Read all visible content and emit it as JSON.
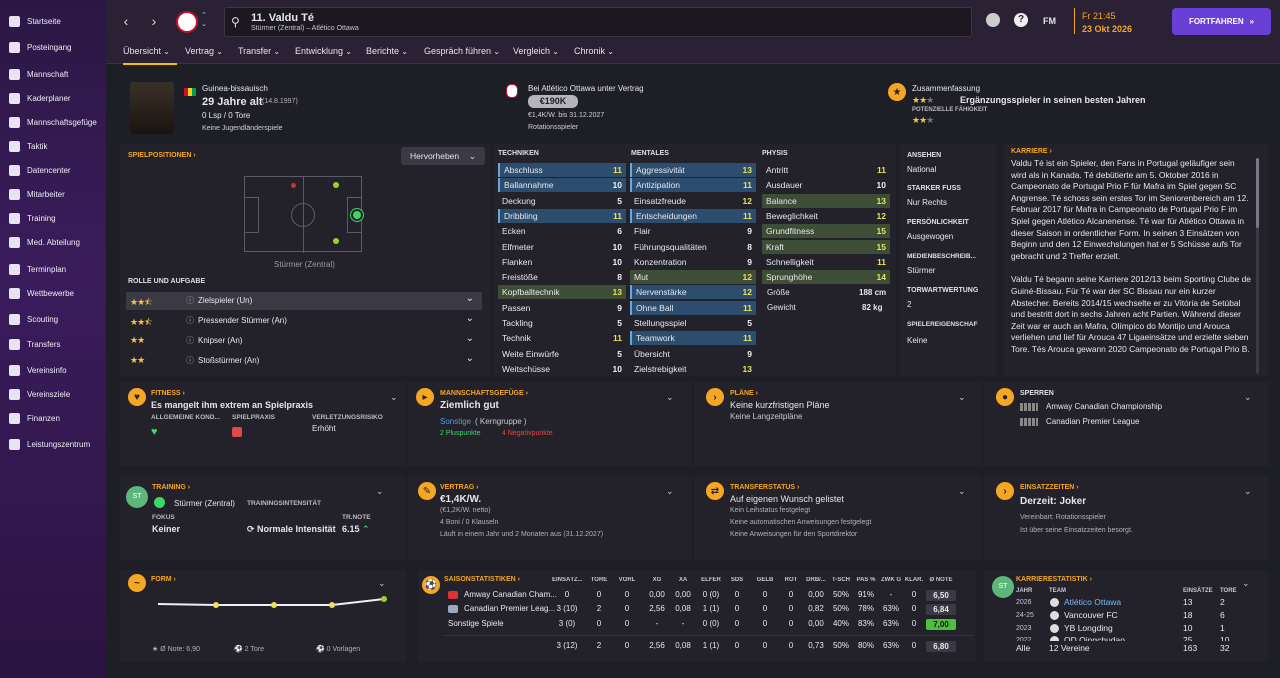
{
  "sidebar": {
    "items": [
      "Startseite",
      "Posteingang",
      "Mannschaft",
      "Kaderplaner",
      "Mannschaftsgefüge",
      "Taktik",
      "Datencenter",
      "Mitarbeiter",
      "Training",
      "Med. Abteilung",
      "Terminplan",
      "Wettbewerbe",
      "Scouting",
      "Transfers",
      "Vereinsinfo",
      "Vereinsziele",
      "Finanzen",
      "Leistungszentrum"
    ]
  },
  "header": {
    "player_name": "11. Valdu Té",
    "player_sub": "Stürmer (Zentral) – Atlético Ottawa",
    "fm": "FM",
    "time": "Fr 21:45",
    "date": "23 Okt 2026",
    "continue_label": "FORTFAHREN"
  },
  "tabs": [
    "Übersicht",
    "Vertrag",
    "Transfer",
    "Entwicklung",
    "Berichte",
    "Gespräch führen",
    "Vergleich",
    "Chronik"
  ],
  "profile": {
    "nationality": "Guinea-bissauisch",
    "age": "29 Jahre alt",
    "dob": "(14.8.1997)",
    "caps": "0 Lsp / 0 Tore",
    "youth": "Keine Jugendländerspiele",
    "contract_club": "Bei Atlético Ottawa unter Vertrag",
    "value": "€190K",
    "wage": "€1,4K/W. bis 31.12.2027",
    "role_status": "Rotationsspieler",
    "summary_label": "Zusammenfassung",
    "summary_text": "Ergänzungsspieler in seinen besten Jahren",
    "potential_label": "POTENZIELLE FÄHIGKEIT"
  },
  "positions": {
    "title": "SPIELPOSITIONEN",
    "highlight": "Hervorheben",
    "position_name": "Stürmer (Zentral)",
    "roles_title": "ROLLE UND AUFGABE",
    "roles": [
      {
        "name": "Zielspieler (Un)",
        "stars": 2.5
      },
      {
        "name": "Pressender Stürmer (An)",
        "stars": 2.5
      },
      {
        "name": "Knipser (An)",
        "stars": 2
      },
      {
        "name": "Stoßstürmer (An)",
        "stars": 2
      }
    ]
  },
  "technical": {
    "title": "TECHNIKEN",
    "rows": [
      [
        "Abschluss",
        "11"
      ],
      [
        "Ballannahme",
        "10"
      ],
      [
        "Deckung",
        "5"
      ],
      [
        "Dribbling",
        "11"
      ],
      [
        "Ecken",
        "6"
      ],
      [
        "Elfmeter",
        "10"
      ],
      [
        "Flanken",
        "10"
      ],
      [
        "Freistöße",
        "8"
      ],
      [
        "Kopfballtechnik",
        "13"
      ],
      [
        "Passen",
        "9"
      ],
      [
        "Tackling",
        "5"
      ],
      [
        "Technik",
        "11"
      ],
      [
        "Weite Einwürfe",
        "5"
      ],
      [
        "Weitschüsse",
        "10"
      ]
    ]
  },
  "mental": {
    "title": "MENTALES",
    "rows": [
      [
        "Aggressivität",
        "13"
      ],
      [
        "Antizipation",
        "11"
      ],
      [
        "Einsatzfreude",
        "12"
      ],
      [
        "Entscheidungen",
        "11"
      ],
      [
        "Flair",
        "9"
      ],
      [
        "Führungsqualitäten",
        "8"
      ],
      [
        "Konzentration",
        "9"
      ],
      [
        "Mut",
        "12"
      ],
      [
        "Nervenstärke",
        "12"
      ],
      [
        "Ohne Ball",
        "11"
      ],
      [
        "Stellungsspiel",
        "5"
      ],
      [
        "Teamwork",
        "11"
      ],
      [
        "Übersicht",
        "9"
      ],
      [
        "Zielstrebigkeit",
        "13"
      ]
    ]
  },
  "physical": {
    "title": "PHYSIS",
    "rows": [
      [
        "Antritt",
        "11"
      ],
      [
        "Ausdauer",
        "10"
      ],
      [
        "Balance",
        "13"
      ],
      [
        "Beweglichkeit",
        "12"
      ],
      [
        "Grundfitness",
        "15"
      ],
      [
        "Kraft",
        "15"
      ],
      [
        "Schnelligkeit",
        "11"
      ],
      [
        "Sprunghöhe",
        "14"
      ]
    ],
    "height_label": "Größe",
    "height": "188 cm",
    "weight_label": "Gewicht",
    "weight": "82 kg"
  },
  "info": {
    "ansehen_label": "ANSEHEN",
    "ansehen": "National",
    "fuss_label": "STARKER FUSS",
    "fuss": "Nur Rechts",
    "pers_label": "PERSÖNLICHKEIT",
    "pers": "Ausgewogen",
    "medien_label": "MEDIENBESCHREIB...",
    "medien": "Stürmer",
    "tw_label": "TORWARTWERTUNG",
    "tw": "2",
    "eig_label": "SPIELEREIGENSCHAF",
    "eig": "Keine"
  },
  "career": {
    "title": "KARRIERE",
    "p1": "Valdu Té ist ein Spieler, den Fans in Portugal geläufiger sein wird als in Kanada. Té debütierte am 5. Oktober 2016 in Campeonato de Portugal Prio F für Mafra im Spiel gegen SC Angrense. Té schoss sein erstes Tor im Seniorenbereich am 12. Februar 2017 für Mafra in Campeonato de Portugal Prio F im Spiel gegen Atlético Alcanenense. Té war für Atlético Ottawa in dieser Saison in ordentlicher Form. In seinen 3 Einsätzen von Beginn und den 12 Einwechslungen hat er 5 Schüsse aufs Tor gebracht und 2 Treffer erzielt.",
    "p2": "Valdu Té begann seine Karriere 2012/13 beim Sporting Clube de Guiné-Bissau. Für Té war der SC Bissau nur ein kurzer Abstecher. Bereits 2014/15 wechselte er zu Vitória de Setúbal und bestritt dort in sechs Jahren acht Partien. Während dieser Zeit war er auch an Mafra, Olímpico do Montijo und Arouca verliehen und lief für Arouca 47 Ligaeinsätze und erzielte sieben Tore. Tés Arouca gewann 2020 Campeonato de Portugal Prio B."
  },
  "fitness": {
    "title": "FITNESS",
    "text": "Es mangelt ihm extrem an Spielpraxis",
    "c1": "ALLGEMEINE KOND...",
    "c2": "SPIELPRAXIS",
    "c3": "VERLETZUNGSRISIKO",
    "risk": "Erhöht"
  },
  "gefuege": {
    "title": "MANNSCHAFTSGEFÜGE",
    "text": "Ziemlich gut",
    "group": "Sonstige",
    "group2": "( Kerngruppe )",
    "plus": "2 Pluspunkte",
    "minus": "4 Negativpunkte"
  },
  "plaene": {
    "title": "PLÄNE",
    "t1": "Keine kurzfristigen Pläne",
    "t2": "Keine Langzeitpläne"
  },
  "sperren": {
    "title": "SPERREN",
    "items": [
      "Amway Canadian Championship",
      "Canadian Premier League"
    ]
  },
  "training": {
    "title": "TRAINING",
    "pos": "Stürmer (Zentral)",
    "fokus_label": "FOKUS",
    "fokus": "Keiner",
    "int_label": "TRAININGSINTENSITÄT",
    "int": "Normale Intensität",
    "note_label": "TR.NOTE",
    "note": "6.15"
  },
  "vertrag": {
    "title": "VERTRAG",
    "wage": "€1,4K/W.",
    "net": "(€1,2K/W. netto)",
    "boni": "4 Boni / 0 Klauseln",
    "runs": "Läuft in einem Jahr und 2 Monaten aus (31.12.2027)"
  },
  "transfer": {
    "title": "TRANSFERSTATUS",
    "text": "Auf eigenen Wunsch gelistet",
    "l1": "Kein Leihstatus festgelegt",
    "l2": "Keine automatischen Anweisungen festgelegt",
    "l3": "Keine Anweisungen für den Sportdirektor"
  },
  "einsatz": {
    "title": "EINSATZZEITEN",
    "text": "Derzeit: Joker",
    "l1": "Vereinbart:  Rotationsspieler",
    "l2": "Ist über seine Einsatzzeiten besorgt."
  },
  "form": {
    "title": "FORM",
    "avg": "Ø Note: 6,90",
    "goals": "2 Tore",
    "assists": "0 Vorlagen"
  },
  "season": {
    "title": "SAISONSTATISTIKEN",
    "headers": [
      "EINSÄTZ...",
      "TORE",
      "VORL",
      "XG",
      "XA",
      "ELFER",
      "SDS",
      "GELB",
      "ROT",
      "DRB/...",
      "T-SCH",
      "PAS %",
      "ZWK G",
      "KLÄR.",
      "Ø NOTE"
    ],
    "rows": [
      [
        "Amway Canadian Cham...",
        "0",
        "0",
        "0",
        "0,00",
        "0,00",
        "0 (0)",
        "0",
        "0",
        "0",
        "0,00",
        "50%",
        "91%",
        "-",
        "0",
        "6,50"
      ],
      [
        "Canadian Premier Leag...",
        "3 (10)",
        "2",
        "0",
        "2,56",
        "0,08",
        "1 (1)",
        "0",
        "0",
        "0",
        "0,82",
        "50%",
        "78%",
        "63%",
        "0",
        "6,84"
      ],
      [
        "Sonstige Spiele",
        "3 (0)",
        "0",
        "0",
        "-",
        "-",
        "0 (0)",
        "0",
        "0",
        "0",
        "0,00",
        "40%",
        "83%",
        "63%",
        "0",
        "7,00"
      ],
      [
        "",
        "3 (12)",
        "2",
        "0",
        "2,56",
        "0,08",
        "1 (1)",
        "0",
        "0",
        "0",
        "0,73",
        "50%",
        "80%",
        "63%",
        "0",
        "6,80"
      ]
    ]
  },
  "karriere": {
    "title": "KARRIERESTATISTIK",
    "h_jahr": "JAHR",
    "h_team": "TEAM",
    "h_eins": "EINSÄTZE",
    "h_tore": "TORE",
    "rows": [
      [
        "2026",
        "Atlético Ottawa",
        "13",
        "2"
      ],
      [
        "24-25",
        "Vancouver FC",
        "18",
        "6"
      ],
      [
        "2023",
        "YB Longding",
        "10",
        "1"
      ],
      [
        "2022",
        "OD Qingchudao",
        "25",
        "10"
      ]
    ],
    "total": [
      "Alle",
      "12 Vereine",
      "163",
      "32"
    ]
  }
}
